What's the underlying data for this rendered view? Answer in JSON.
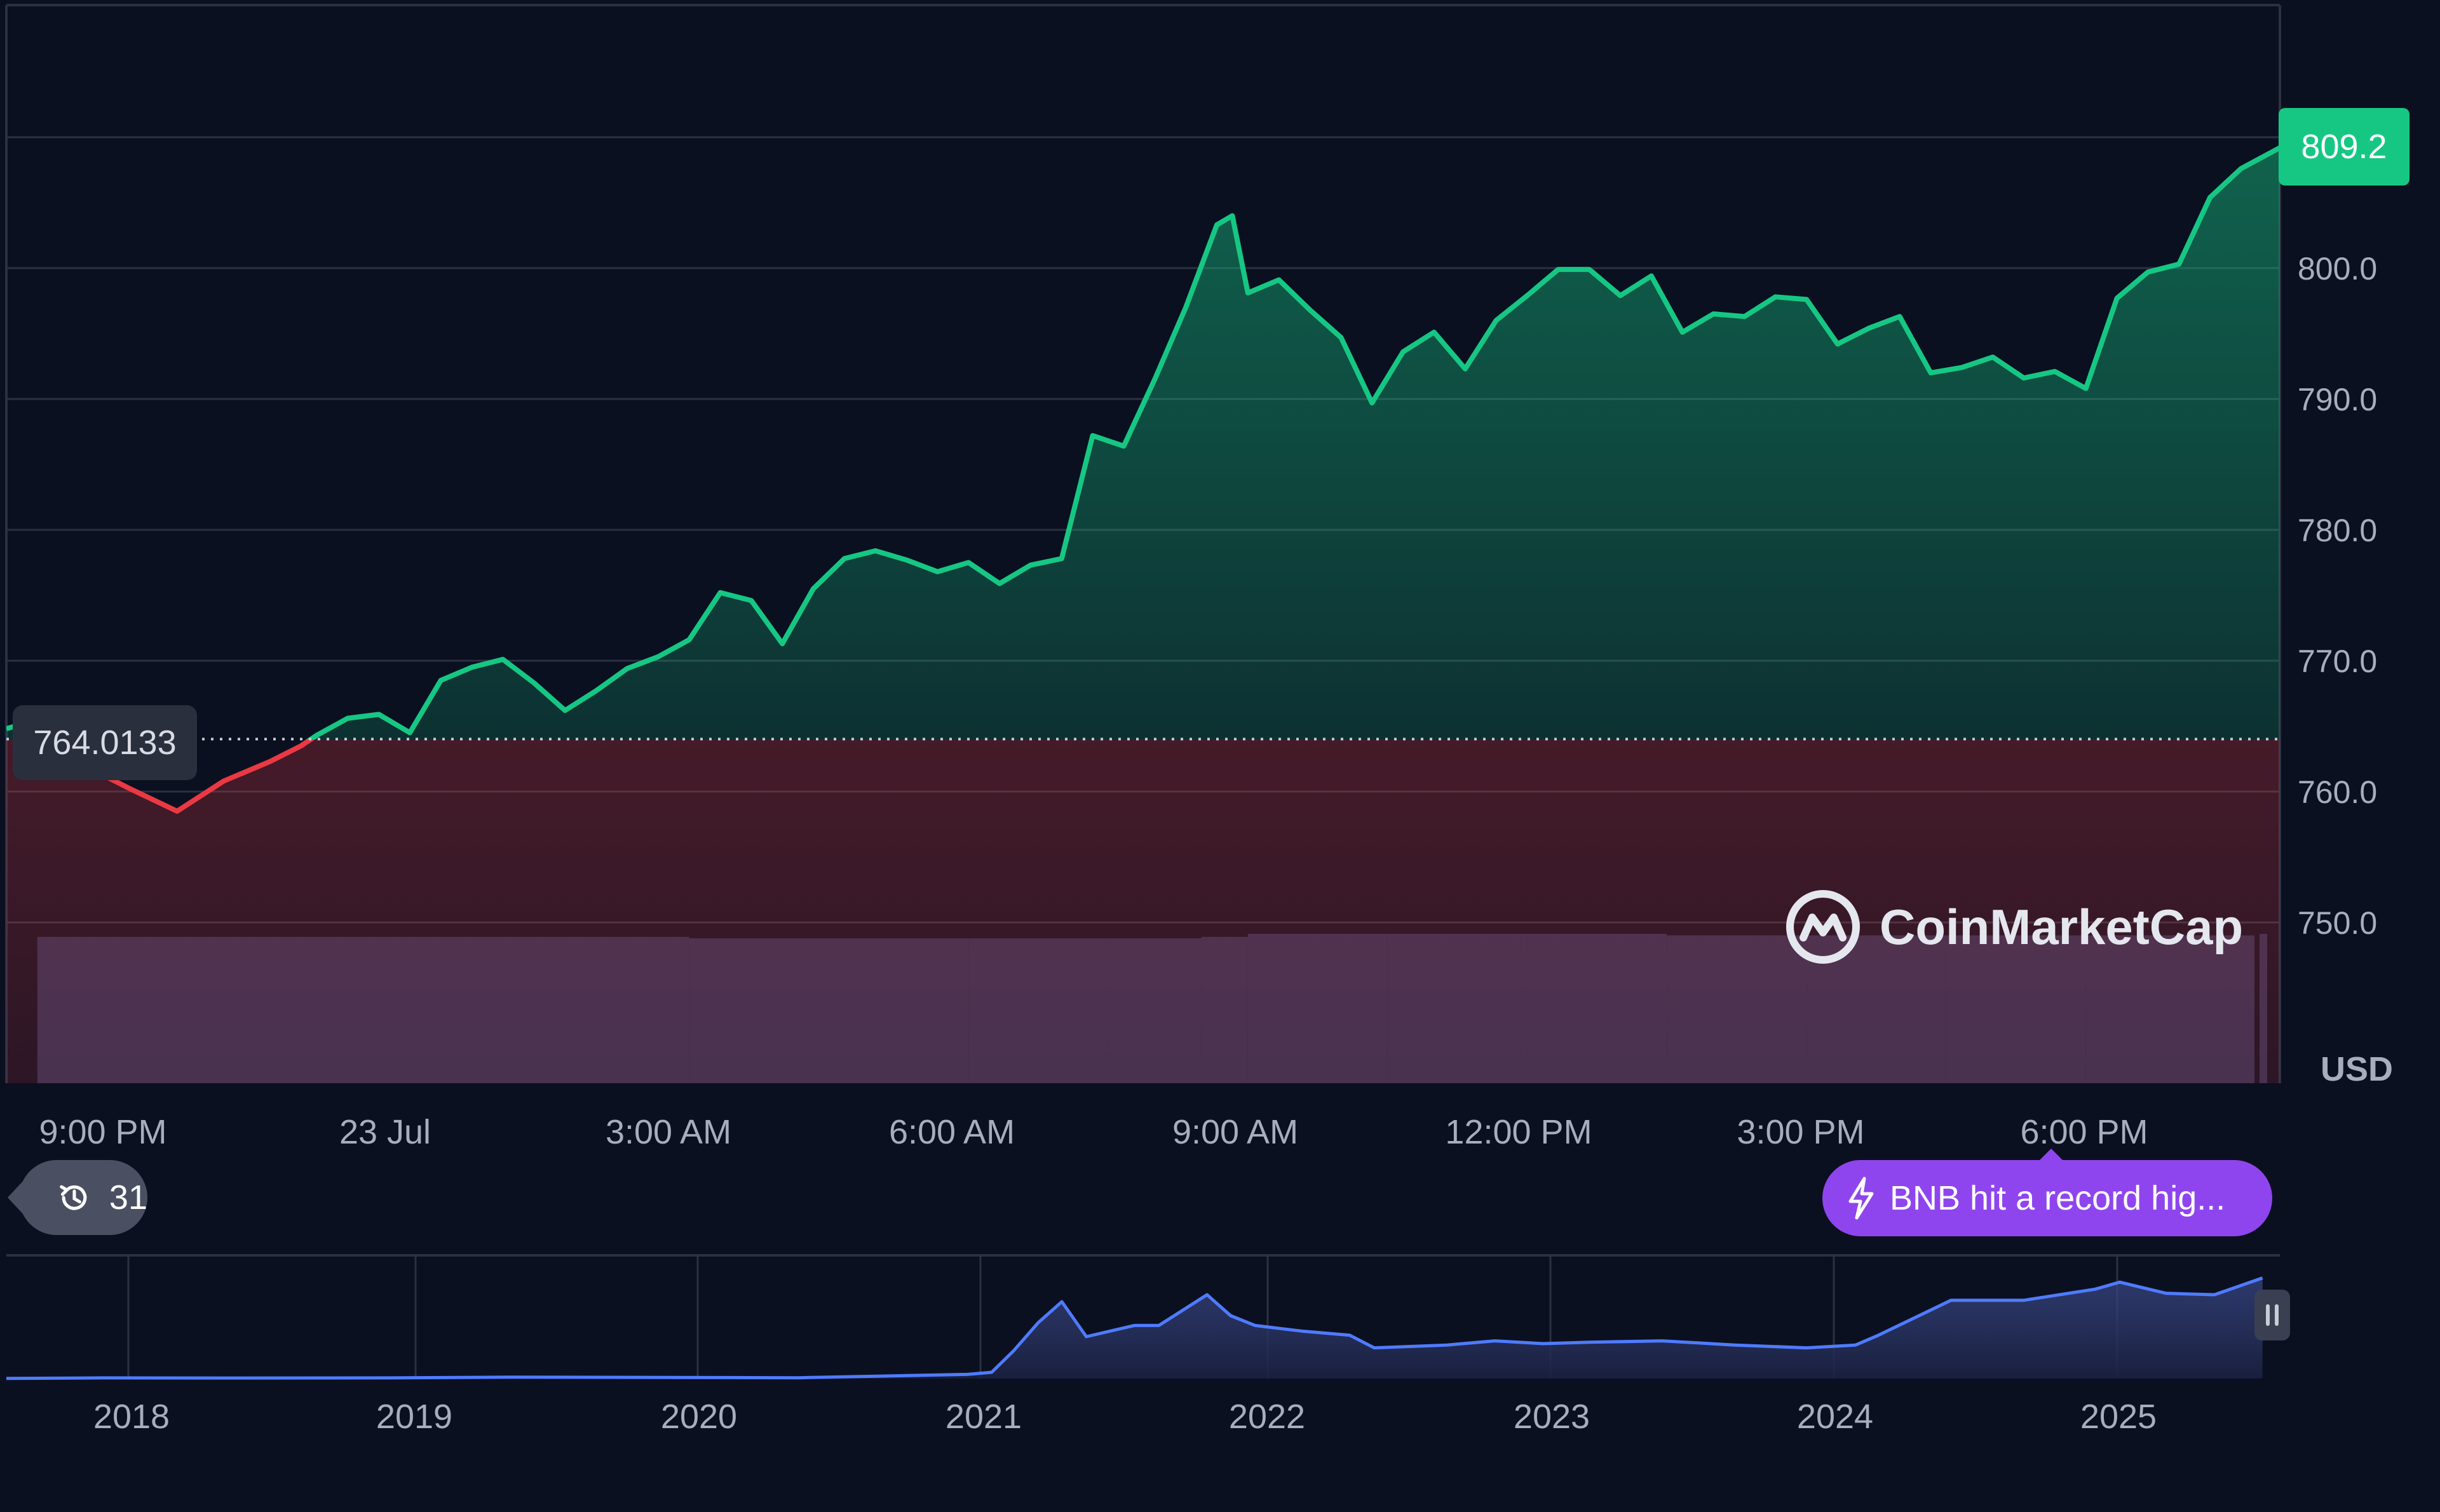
{
  "chart_data": [
    {
      "type": "area",
      "title": "",
      "xlabel": "",
      "ylabel": "",
      "currency": "USD",
      "ylim": [
        740,
        820
      ],
      "y_ticks": [
        "800.0",
        "790.0",
        "780.0",
        "770.0",
        "760.0",
        "750.0"
      ],
      "x_ticks": [
        "9:00 PM",
        "23 Jul",
        "3:00 AM",
        "6:00 AM",
        "9:00 AM",
        "12:00 PM",
        "3:00 PM",
        "6:00 PM"
      ],
      "x_range": [
        "2025-07-22 19:40",
        "2025-07-23 20:05"
      ],
      "reference_price": "764.0133",
      "last_price": "809.2",
      "line_color_up": "#16c784",
      "line_color_down": "#ea3943",
      "series": [
        {
          "x": [
            "2025-07-22 19:40",
            "2025-07-22 20:00",
            "2025-07-22 20:30",
            "2025-07-22 21:00",
            "2025-07-22 21:30",
            "2025-07-22 22:00",
            "2025-07-22 22:30",
            "2025-07-22 22:50",
            "2025-07-22 23:00",
            "2025-07-22 23:20",
            "2025-07-22 23:40",
            "2025-07-23 00:00",
            "2025-07-23 00:20",
            "2025-07-23 00:40",
            "2025-07-23 01:00",
            "2025-07-23 01:20",
            "2025-07-23 01:40",
            "2025-07-23 02:00",
            "2025-07-23 02:20",
            "2025-07-23 02:40",
            "2025-07-23 03:00",
            "2025-07-23 03:20",
            "2025-07-23 03:40",
            "2025-07-23 04:00",
            "2025-07-23 04:20",
            "2025-07-23 04:40",
            "2025-07-23 05:00",
            "2025-07-23 05:20",
            "2025-07-23 05:40",
            "2025-07-23 06:00",
            "2025-07-23 06:20",
            "2025-07-23 06:40",
            "2025-07-23 07:00",
            "2025-07-23 07:20",
            "2025-07-23 07:40",
            "2025-07-23 08:00",
            "2025-07-23 08:20",
            "2025-07-23 08:40",
            "2025-07-23 08:50",
            "2025-07-23 09:00",
            "2025-07-23 09:20",
            "2025-07-23 09:40",
            "2025-07-23 10:00",
            "2025-07-23 10:20",
            "2025-07-23 10:40",
            "2025-07-23 11:00",
            "2025-07-23 11:20",
            "2025-07-23 11:40",
            "2025-07-23 12:00",
            "2025-07-23 12:20",
            "2025-07-23 12:40",
            "2025-07-23 13:00",
            "2025-07-23 13:20",
            "2025-07-23 13:40",
            "2025-07-23 14:00",
            "2025-07-23 14:20",
            "2025-07-23 14:40",
            "2025-07-23 15:00",
            "2025-07-23 15:20",
            "2025-07-23 15:40",
            "2025-07-23 16:00",
            "2025-07-23 16:20",
            "2025-07-23 16:40",
            "2025-07-23 17:00",
            "2025-07-23 17:20",
            "2025-07-23 17:40",
            "2025-07-23 18:00",
            "2025-07-23 18:20",
            "2025-07-23 18:40",
            "2025-07-23 19:00",
            "2025-07-23 19:20",
            "2025-07-23 19:40",
            "2025-07-23 20:05"
          ],
          "values": [
            764.8,
            765.5,
            762.0,
            760.2,
            758.5,
            760.8,
            762.3,
            763.5,
            764.3,
            765.6,
            765.9,
            764.5,
            768.5,
            769.5,
            770.1,
            768.3,
            766.2,
            767.7,
            769.4,
            770.3,
            771.6,
            775.2,
            774.6,
            771.3,
            775.5,
            777.8,
            778.4,
            777.7,
            776.8,
            777.5,
            775.9,
            777.3,
            777.8,
            787.2,
            786.4,
            791.5,
            797.0,
            803.3,
            804.0,
            798.1,
            799.1,
            796.8,
            794.7,
            789.7,
            793.6,
            795.1,
            792.3,
            796.0,
            797.9,
            799.9,
            799.9,
            797.9,
            799.4,
            795.1,
            796.5,
            796.3,
            797.8,
            797.6,
            794.2,
            795.4,
            796.3,
            792.0,
            792.4,
            793.2,
            791.6,
            792.1,
            790.8,
            797.7,
            799.7,
            800.3,
            805.4,
            807.6,
            809.2
          ]
        }
      ]
    },
    {
      "type": "bar",
      "title": "",
      "xlabel": "",
      "ylabel": "",
      "color": "#2b3152",
      "x": [
        "2025-07-22 20:00",
        "2025-07-23 00:00",
        "2025-07-23 03:00",
        "2025-07-23 06:00",
        "2025-07-23 07:30",
        "2025-07-23 08:30",
        "2025-07-23 09:00",
        "2025-07-23 10:30",
        "2025-07-23 12:00",
        "2025-07-23 13:30",
        "2025-07-23 15:00",
        "2025-07-23 16:30",
        "2025-07-23 18:00",
        "2025-07-23 19:30"
      ],
      "values": [
        98,
        98,
        97,
        97,
        97,
        98,
        100,
        100,
        100,
        99,
        99,
        99,
        99,
        99
      ]
    },
    {
      "type": "area",
      "title": "",
      "xlabel": "",
      "ylabel": "",
      "x_ticks": [
        "2018",
        "2019",
        "2020",
        "2021",
        "2022",
        "2023",
        "2024",
        "2025"
      ],
      "line_color": "#4f7bff",
      "series": [
        {
          "x": [
            "2017-09",
            "2018-01",
            "2018-06",
            "2019-01",
            "2019-06",
            "2020-01",
            "2020-06",
            "2021-01",
            "2021-02",
            "2021-03",
            "2021-04",
            "2021-05",
            "2021-06",
            "2021-08",
            "2021-09",
            "2021-11",
            "2021-12",
            "2022-01",
            "2022-03",
            "2022-05",
            "2022-06",
            "2022-09",
            "2022-11",
            "2023-01",
            "2023-03",
            "2023-06",
            "2023-09",
            "2023-12",
            "2024-02",
            "2024-03",
            "2024-06",
            "2024-09",
            "2024-12",
            "2025-01",
            "2025-03",
            "2025-05",
            "2025-07"
          ],
          "values": [
            1,
            5,
            4,
            5,
            10,
            8,
            6,
            30,
            45,
            200,
            400,
            550,
            300,
            380,
            380,
            600,
            450,
            380,
            340,
            310,
            220,
            240,
            270,
            250,
            260,
            270,
            240,
            220,
            240,
            310,
            560,
            560,
            640,
            690,
            610,
            600,
            720
          ]
        }
      ]
    }
  ],
  "labels": {
    "currency": "USD",
    "last_price": "809.2",
    "reference_price": "764.0133",
    "history_count": "31",
    "news_text": "BNB hit a record hig...",
    "watermark": "CoinMarketCap"
  },
  "icons": {
    "history": "history-icon",
    "news": "lightning-icon",
    "logo": "coinmarketcap-logo",
    "navigator_handle": "pause-handle-icon"
  },
  "colors": {
    "background": "#0b1020",
    "grid": "#2b3142",
    "up": "#16c784",
    "down": "#ea3943",
    "volume": "#2b3152",
    "navigator_line": "#4f7bff",
    "news": "#8f45ee"
  }
}
